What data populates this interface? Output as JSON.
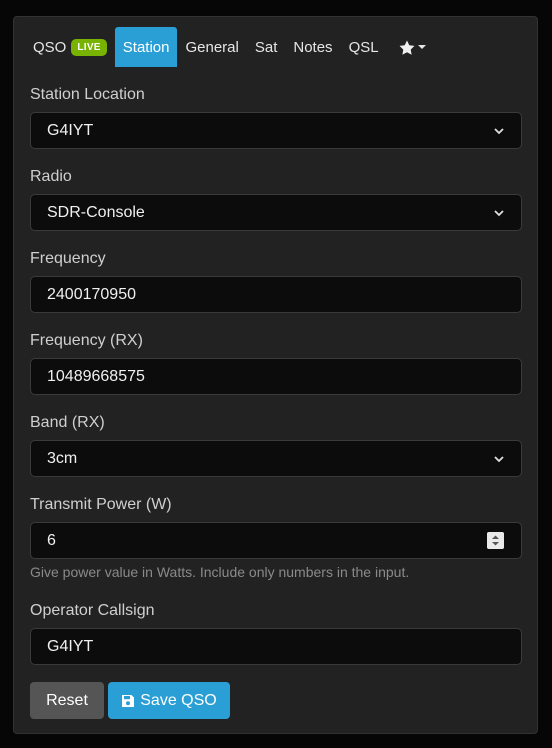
{
  "tabs": [
    {
      "label": "QSO",
      "badge": "LIVE"
    },
    {
      "label": "Station"
    },
    {
      "label": "General"
    },
    {
      "label": "Sat"
    },
    {
      "label": "Notes"
    },
    {
      "label": "QSL"
    }
  ],
  "active_tab": "Station",
  "favorites_icon": "star-icon",
  "form": {
    "station_location": {
      "label": "Station Location",
      "value": "G4IYT"
    },
    "radio": {
      "label": "Radio",
      "value": "SDR-Console"
    },
    "frequency": {
      "label": "Frequency",
      "value": "2400170950"
    },
    "frequency_rx": {
      "label": "Frequency (RX)",
      "value": "10489668575"
    },
    "band_rx": {
      "label": "Band (RX)",
      "value": "3cm"
    },
    "transmit_power": {
      "label": "Transmit Power (W)",
      "value": "6",
      "help": "Give power value in Watts. Include only numbers in the input."
    },
    "operator_callsign": {
      "label": "Operator Callsign",
      "value": "G4IYT"
    }
  },
  "buttons": {
    "reset": "Reset",
    "save": "Save QSO"
  },
  "colors": {
    "accent": "#2a9fd6",
    "badge": "#77b300",
    "reset": "#555555"
  }
}
